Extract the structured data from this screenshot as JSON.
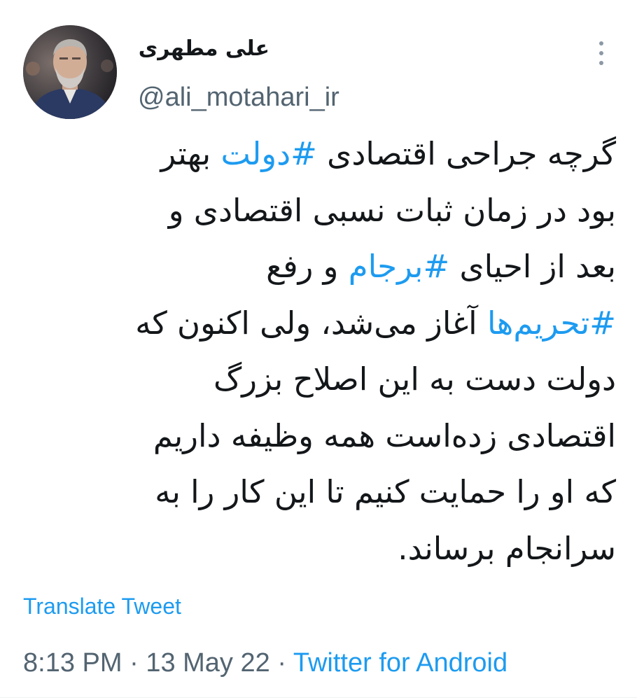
{
  "author": {
    "display_name": "علی مطهری",
    "handle": "@ali_motahari_ir"
  },
  "tweet": {
    "lines": [
      [
        {
          "text": "گرچه جراحی اقتصادی ",
          "hashtag": false
        },
        {
          "text": "#دولت",
          "hashtag": true
        },
        {
          "text": " بهتر",
          "hashtag": false
        }
      ],
      [
        {
          "text": "بود در زمان ثبات نسبی اقتصادی و",
          "hashtag": false
        }
      ],
      [
        {
          "text": "بعد از احیای ",
          "hashtag": false
        },
        {
          "text": "#برجام",
          "hashtag": true
        },
        {
          "text": " و رفع",
          "hashtag": false
        }
      ],
      [
        {
          "text": "#تحریم‌ها",
          "hashtag": true
        },
        {
          "text": " آغاز می‌شد، ولی اکنون که",
          "hashtag": false
        }
      ],
      [
        {
          "text": "دولت دست به این اصلاح بزرگ",
          "hashtag": false
        }
      ],
      [
        {
          "text": "اقتصادی زده‌است همه وظیفه داریم",
          "hashtag": false
        }
      ],
      [
        {
          "text": "که او را حمایت کنیم تا این کار را به",
          "hashtag": false
        }
      ],
      [
        {
          "text": "سرانجام برساند.",
          "hashtag": false
        }
      ]
    ],
    "translate_label": "Translate Tweet",
    "time": "8:13 PM",
    "date": "13 May 22",
    "separator": "·",
    "source": "Twitter for Android"
  },
  "colors": {
    "link": "#1d9bf0",
    "text": "#14171a",
    "secondary": "#536471"
  },
  "icons": {
    "more": "more-vertical-icon",
    "avatar": "profile-photo"
  }
}
